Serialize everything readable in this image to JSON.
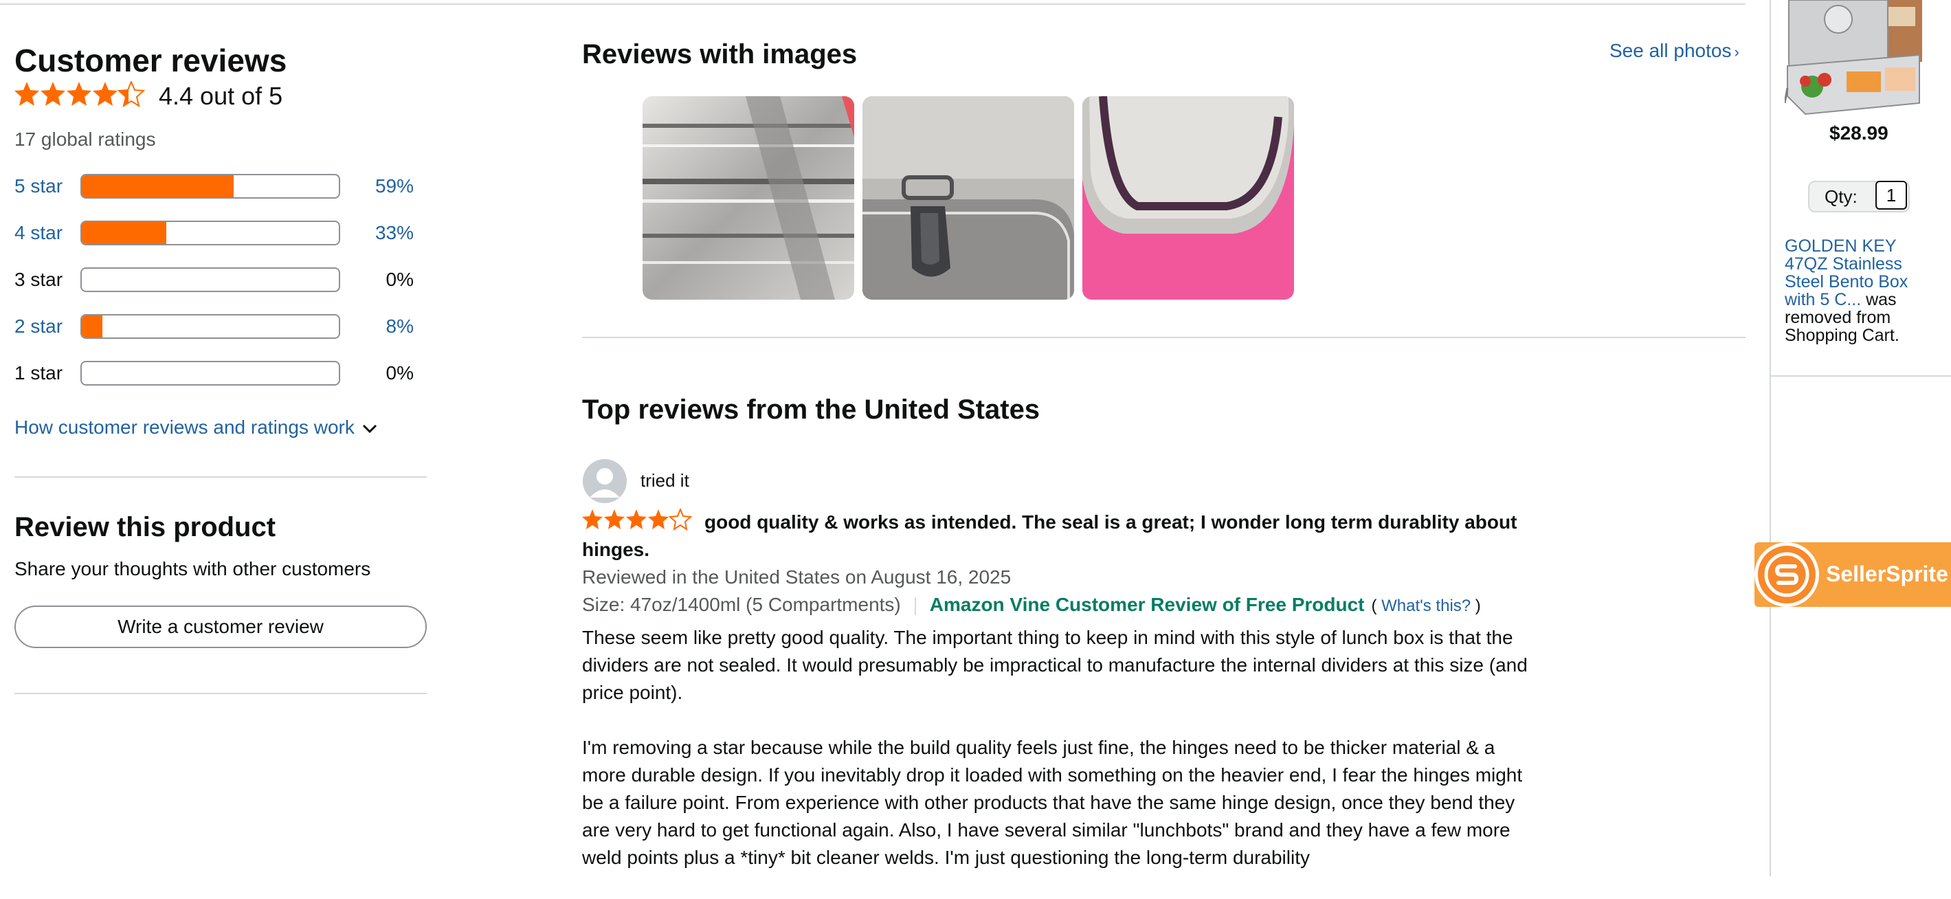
{
  "ratings": {
    "heading": "Customer reviews",
    "average": 4.4,
    "average_text": "4.4 out of 5",
    "global_ratings": "17 global ratings",
    "histogram": [
      {
        "label": "5 star",
        "percent_text": "59%",
        "fraction": 0.59,
        "linked": true
      },
      {
        "label": "4 star",
        "percent_text": "33%",
        "fraction": 0.33,
        "linked": true
      },
      {
        "label": "3 star",
        "percent_text": "0%",
        "fraction": 0.0,
        "linked": false
      },
      {
        "label": "2 star",
        "percent_text": "8%",
        "fraction": 0.08,
        "linked": true
      },
      {
        "label": "1 star",
        "percent_text": "0%",
        "fraction": 0.0,
        "linked": false
      }
    ],
    "how_link": "How customer reviews and ratings work"
  },
  "review_product": {
    "heading": "Review this product",
    "subtext": "Share your thoughts with other customers",
    "button_label": "Write a customer review"
  },
  "images_section": {
    "heading": "Reviews with images",
    "see_all": "See all photos",
    "thumbnails": [
      "lunch-box-dividers-photo",
      "lunch-box-latch-photo",
      "lunch-box-seal-photo"
    ]
  },
  "top_reviews": {
    "heading": "Top reviews from the United States",
    "review": {
      "reviewer": "tried it",
      "rating": 4,
      "title": "good quality & works as intended. The seal is a great; I wonder long term durablity about hinges.",
      "date_line": "Reviewed in the United States on August 16, 2025",
      "size": "Size: 47oz/1400ml (5 Compartments)",
      "vine_badge": "Amazon Vine Customer Review of Free Product",
      "whats_this": "What's this?",
      "body_paragraphs": [
        "These seem like pretty good quality. The important thing to keep in mind with this style of lunch box is that the dividers are not sealed. It would presumably be impractical to manufacture the internal dividers at this size (and price point).",
        "I'm removing a star because while the build quality feels just fine, the hinges need to be thicker material & a more durable design. If you inevitably drop it loaded with something on the heavier end, I fear the hinges might be a failure point. From experience with other products that have the same hinge design, once they bend they are very hard to get functional again. Also, I have several similar \"lunchbots\" brand and they have a few more weld points plus a *tiny* bit cleaner welds. I'm just questioning the long-term durability"
      ]
    }
  },
  "sidebar": {
    "price": "$28.99",
    "qty_label": "Qty:",
    "qty_value": "1",
    "removed_product_link": "GOLDEN KEY 47QZ Stainless Steel Bento Box with 5 C...",
    "removed_suffix": " was removed from Shopping Cart."
  },
  "extension": {
    "name": "SellerSprite"
  },
  "colors": {
    "star": "#ff6a00",
    "bar_fill": "#ff6a00",
    "link": "#2162a1",
    "vine": "#067d62",
    "extension_orange": "#f8a13f"
  }
}
